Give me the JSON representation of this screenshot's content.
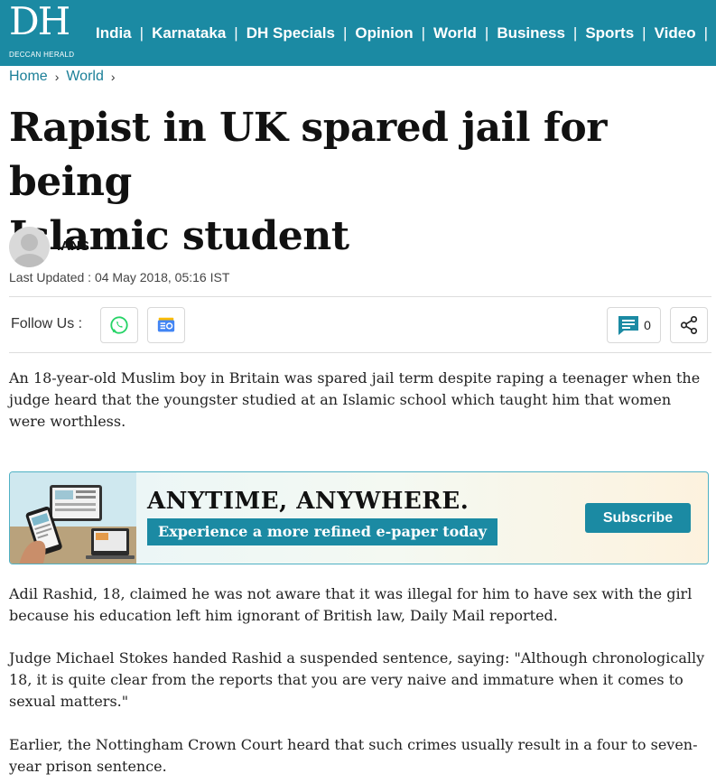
{
  "brand": {
    "logo_text": "DH",
    "logo_subtitle": "DECCAN HERALD",
    "primary_color": "#1b8aa3"
  },
  "nav": {
    "items": [
      "India",
      "Karnataka",
      "DH Specials",
      "Opinion",
      "World",
      "Business",
      "Sports",
      "Video"
    ],
    "separator": "|"
  },
  "breadcrumb": {
    "items": [
      "Home",
      "World"
    ],
    "separator": "›"
  },
  "article": {
    "headline_line1": "Rapist in UK spared jail for being",
    "headline_line2": "Islamic student",
    "author": "IANS",
    "last_updated": "Last Updated : 04 May 2018, 05:16 IST",
    "paragraphs": [
      "An 18-year-old Muslim boy in Britain was spared jail term despite raping a teenager when the judge heard that the youngster studied at an Islamic school which taught him that women were worthless.",
      "Adil Rashid, 18, claimed he was not aware that it was illegal for him to have sex with the girl because his education left him ignorant of British law, Daily Mail reported.",
      "Judge Michael Stokes handed Rashid a suspended sentence, saying: \"Although chronologically 18, it is quite clear from the reports that you are very naive and immature when it comes to sexual matters.\"",
      "Earlier, the Nottingham Crown Court heard that such crimes usually result in a four to seven-year prison sentence."
    ]
  },
  "follow": {
    "label": "Follow Us :",
    "icons": [
      "whatsapp-icon",
      "google-news-icon"
    ],
    "comment_count": "0",
    "share_icon": "share-icon"
  },
  "banner": {
    "title": "ANYTIME, ANYWHERE.",
    "tagline": "Experience a more refined e-paper today",
    "button_label": "Subscribe"
  }
}
